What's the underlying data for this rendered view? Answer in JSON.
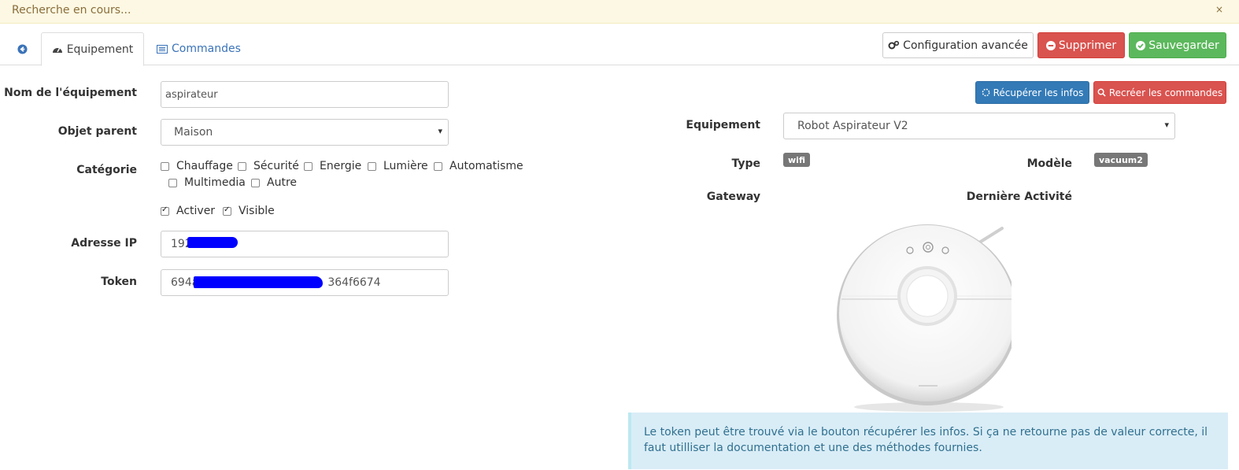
{
  "alert": {
    "message": "Recherche en cours...",
    "close": "×"
  },
  "tabs": {
    "back_icon": "arrow-circle-left-icon",
    "equipment": "Equipement",
    "commands": "Commandes"
  },
  "toolbar": {
    "config": "Configuration avancée",
    "delete": "Supprimer",
    "save": "Sauvegarder"
  },
  "form": {
    "name_label": "Nom de l'équipement",
    "name_value": "aspirateur",
    "parent_label": "Objet parent",
    "parent_value": "Maison",
    "category_label": "Catégorie",
    "categories": [
      "Chauffage",
      "Sécurité",
      "Energie",
      "Lumière",
      "Automatisme",
      "Multimedia",
      "Autre"
    ],
    "enable_label": "Activer",
    "visible_label": "Visible",
    "ip_label": "Adresse IP",
    "ip_value": "192",
    "token_label": "Token",
    "token_prefix": "694a",
    "token_suffix": "364f6674"
  },
  "right": {
    "fetch": "Récupérer les infos",
    "recreate": "Recréer les commandes",
    "device_label": "Equipement",
    "device_value": "Robot Aspirateur V2",
    "type_label": "Type",
    "type_value": "wifi",
    "model_label": "Modèle",
    "model_value": "vacuum2",
    "gateway_label": "Gateway",
    "activity_label": "Dernière Activité",
    "info": "Le token peut être trouvé via le bouton récupérer les infos. Si ça ne retourne pas de valeur correcte, il faut utilliser la documentation et une des méthodes fournies."
  },
  "colors": {
    "primary": "#337ab7",
    "danger": "#d9534f",
    "success": "#5cb85c",
    "warning_bg": "#fcf8e3",
    "info_bg": "#d9edf7"
  }
}
